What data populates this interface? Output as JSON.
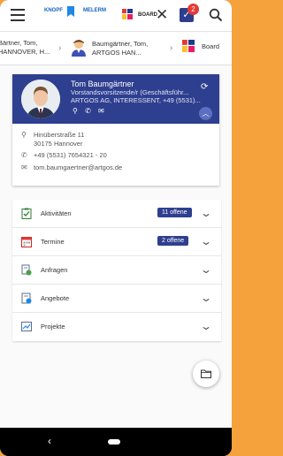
{
  "appbar": {
    "mini_label_1": "KNOPF",
    "mini_label_2": "MELERM",
    "board_label": "BOARD",
    "notification_count": "2"
  },
  "tabs": [
    {
      "label": "Bärtner, Tom, HANNOVER, H..."
    },
    {
      "label": "Baumgärtner, Tom, ARTGOS HAN..."
    },
    {
      "label": "Board"
    }
  ],
  "contact": {
    "name": "Tom Baumgärtner",
    "role": "Vorstandsvorsitzende/r (Geschäftsführ...",
    "org": "ARTGOS AG, INTERESSENT, +49 (5531)...",
    "address_line1": "Hinüberstraße 11",
    "address_line2": "30175 Hannover",
    "phone": "+49 (5531) 7654321 - 20",
    "email": "tom.baumgaertner@artgos.de"
  },
  "sections": [
    {
      "label": "Aktivitäten",
      "badge": "11 offene",
      "icon": "clipboard-check-icon"
    },
    {
      "label": "Termine",
      "badge": "2 offene",
      "icon": "calendar-icon"
    },
    {
      "label": "Anfragen",
      "badge": "",
      "icon": "request-icon"
    },
    {
      "label": "Angebote",
      "badge": "",
      "icon": "offer-icon"
    },
    {
      "label": "Projekte",
      "badge": "",
      "icon": "project-icon"
    }
  ],
  "colors": {
    "accent": "#2f3f8f",
    "frame": "#f6a23c"
  }
}
